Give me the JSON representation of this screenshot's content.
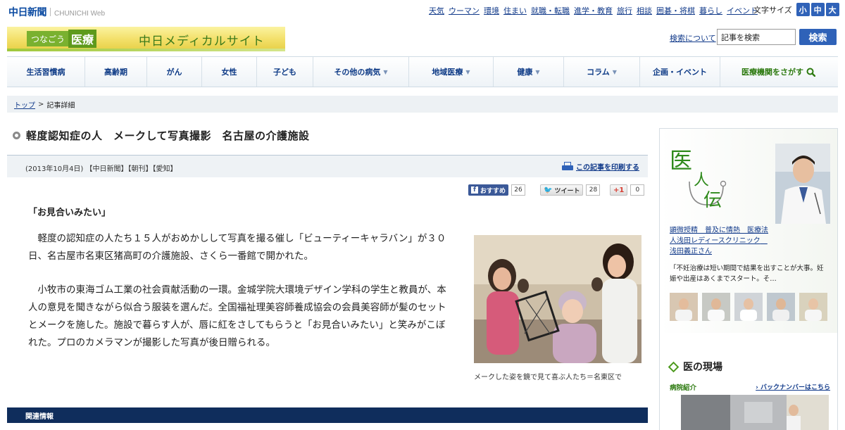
{
  "site": {
    "logo": "中日新聞",
    "logo_sub": "CHUNICHI Web"
  },
  "top_links": [
    "天気",
    "ウーマン",
    "環境",
    "住まい",
    "就職・転職",
    "進学・教育",
    "旅行",
    "相談",
    "囲碁・将棋",
    "暮らし",
    "イベント"
  ],
  "font_size": {
    "label": "文字サイズ",
    "options": [
      "小",
      "中",
      "大"
    ]
  },
  "brand": {
    "tagline": "つなごう",
    "mark": "医療",
    "title": "中日メディカルサイト"
  },
  "search": {
    "about": "検索について",
    "value": "記事を検索",
    "button": "検索"
  },
  "nav": [
    {
      "label": "生活習慣病",
      "dropdown": false
    },
    {
      "label": "高齢期",
      "dropdown": false
    },
    {
      "label": "がん",
      "dropdown": false
    },
    {
      "label": "女性",
      "dropdown": false
    },
    {
      "label": "子ども",
      "dropdown": false
    },
    {
      "label": "その他の病気",
      "dropdown": true
    },
    {
      "label": "地域医療",
      "dropdown": true
    },
    {
      "label": "健康",
      "dropdown": true
    },
    {
      "label": "コラム",
      "dropdown": true
    },
    {
      "label": "企画・イベント",
      "dropdown": false
    },
    {
      "label": "医療機関をさがす",
      "dropdown": false
    }
  ],
  "breadcrumb": {
    "top": "トップ",
    "sep": ">",
    "current": "記事詳細"
  },
  "article": {
    "title": "軽度認知症の人　メークして写真撮影　名古屋の介護施設",
    "meta": "(2013年10月4日) 【中日新聞】【朝刊】【愛知】",
    "print": "この記事を印刷する",
    "lead": "「お見合いみたい」",
    "paragraphs": [
      "　軽度の認知症の人たち１５人がおめかしして写真を撮る催し「ビューティーキャラバン」が３０日、名古屋市名東区猪高町の介護施設、さくら一番館で開かれた。",
      "　小牧市の東海ゴム工業の社会貢献活動の一環。金城学院大環境デザイン学科の学生と教員が、本人の意見を聞きながら似合う服装を選んだ。全国福祉理美容師養成協会の会員美容師が髪のセットとメークを施した。施設で暮らす人が、唇に紅をさしてもらうと「お見合いみたい」と笑みがこぼれた。プロのカメラマンが撮影した写真が後日贈られる。"
    ],
    "photo_caption": "メークした姿を鏡で見て喜ぶ人たち＝名東区で"
  },
  "social": {
    "facebook_label": "おすすめ",
    "facebook_count": "26",
    "twitter_label": "ツイート",
    "twitter_count": "28",
    "gplus_label": "+1",
    "gplus_count": "0"
  },
  "related_header": "関連情報",
  "sidebar": {
    "ijin_title_chars": [
      "医",
      "人",
      "伝"
    ],
    "ijin_link": "顕微授精　普及に情熱　医療法人浅田レディースクリニック　浅田義正さん",
    "ijin_quote": "「不妊治療は短い期間で結果を出すことが大事。妊娠や出産はあくまでスタート。そ…",
    "genba_title": "医の現場",
    "genba_sub": "病院紹介",
    "backnumber": "バックナンバーはこちら"
  },
  "colors": {
    "nav_text": "#0d3a86",
    "accent_blue": "#2f62b8",
    "related_bar": "#0f2d5c",
    "green": "#2d7a10"
  }
}
